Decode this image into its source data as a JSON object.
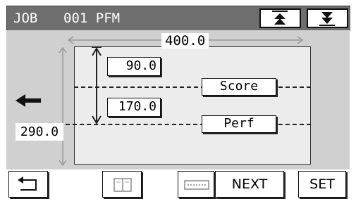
{
  "header": {
    "job_label": "JOB",
    "job_name": "001 PFM",
    "up_icon": "triangle-up-icon",
    "down_icon": "triangle-down-icon"
  },
  "dimensions": {
    "width": "400.0",
    "length": "290.0",
    "score_position": "90.0",
    "perf_position": "170.0"
  },
  "lines": {
    "score_label": "Score",
    "perf_label": "Perf"
  },
  "toolbar": {
    "back_icon": "return-arrow-icon",
    "book_icon": "open-book-icon",
    "keyboard_icon": "keypad-icon",
    "next_label": "NEXT",
    "set_label": "SET"
  },
  "colors": {
    "title_bar": "#6e6e6e",
    "work_area": "#d0d0d0",
    "sheet": "#ececec"
  }
}
